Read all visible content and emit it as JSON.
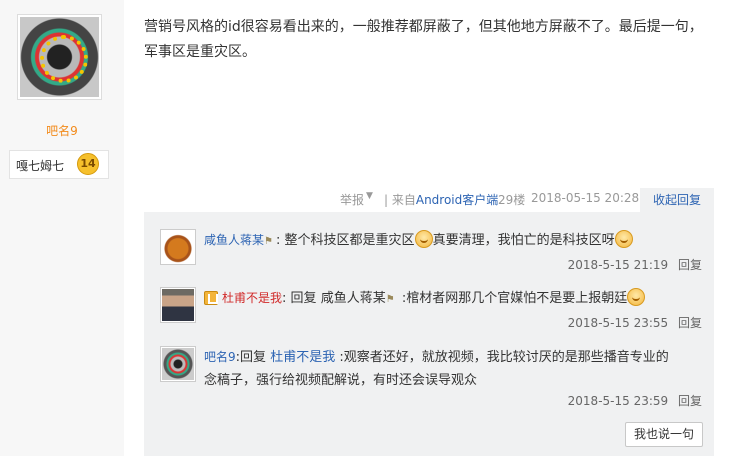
{
  "author": {
    "name": "吧名9",
    "badge_name": "嘎七姆七",
    "badge_level": "14"
  },
  "post": {
    "text_line1": "营销号风格的id很容易看出来的，一般推荐都屏蔽了，但其他地方屏蔽不了。最后提一句，",
    "text_line2": "军事区是重灾区。"
  },
  "meta": {
    "report": "举报",
    "from_prefix": "| 来自",
    "client": "Android客户端",
    "floor": "29楼",
    "time": "2018-05-15 20:28",
    "collapse": "收起回复"
  },
  "replies": [
    {
      "name": "咸鱼人蒋某",
      "name_suffix": ":",
      "text": "整个科技区都是重灾区",
      "text2": "真要清理，我怕亡的是科技区呀",
      "time": "2018-5-15 21:19",
      "reply_label": "回复"
    },
    {
      "name": "杜甫不是我",
      "name_suffix": ":",
      "reply_prefix": "回复",
      "target": "咸鱼人蒋某",
      "text": ":棺材者网那几个官媒怕不是要上报朝廷",
      "time": "2018-5-15 23:55",
      "reply_label": "回复"
    },
    {
      "name": "吧名9",
      "name_suffix": ":",
      "reply_prefix": "回复",
      "target": "杜甫不是我",
      "text_line1": ":观察者还好，就放视频，我比较讨厌的是那些播音专业的",
      "text_line2": "念稿子，强行给视频配解说，有时还会误导观众",
      "time": "2018-5-15 23:59",
      "reply_label": "回复"
    }
  ],
  "say_button": "我也说一句"
}
